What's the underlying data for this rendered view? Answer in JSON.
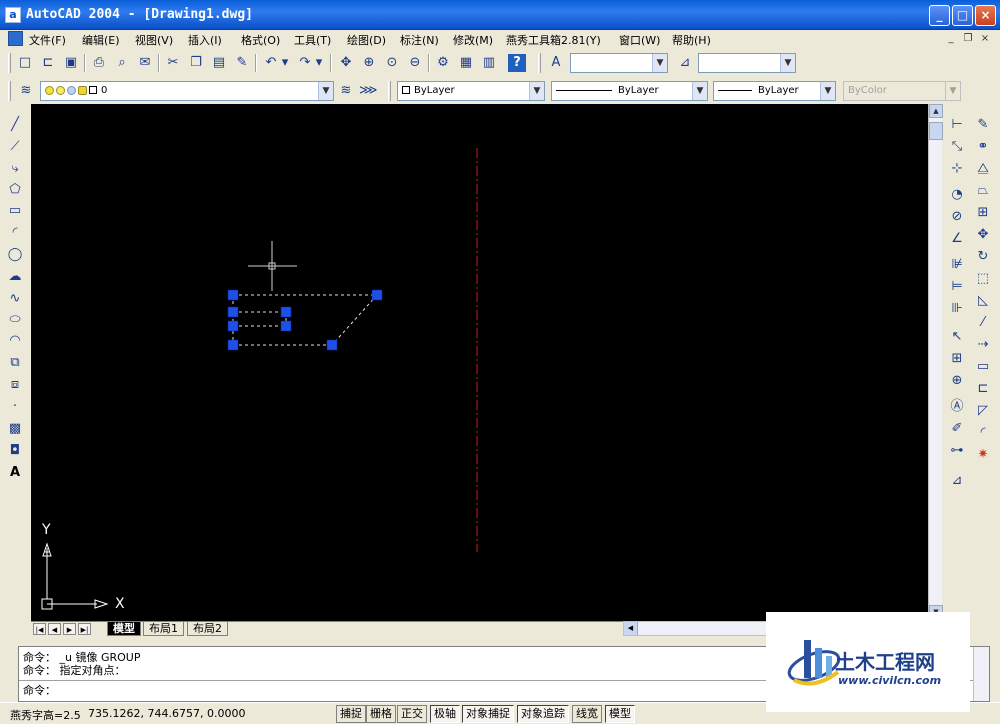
{
  "window": {
    "title": "AutoCAD 2004 - [Drawing1.dwg]",
    "app_icon_letter": "a",
    "minimize": "_",
    "maximize": "□",
    "close": "×"
  },
  "menu": {
    "items": [
      "文件(F)",
      "编辑(E)",
      "视图(V)",
      "插入(I)",
      "格式(O)",
      "工具(T)",
      "绘图(D)",
      "标注(N)",
      "修改(M)",
      "燕秀工具箱2.81(Y)",
      "窗口(W)",
      "帮助(H)"
    ],
    "mdi_minimize": "_",
    "mdi_restore": "❐",
    "mdi_close": "×"
  },
  "layers": {
    "current_layer": "0"
  },
  "properties": {
    "color": "ByLayer",
    "linetype": "ByLayer",
    "lineweight": "ByLayer",
    "plotstyle": "ByColor"
  },
  "axes": {
    "y_label": "Y",
    "x_label": "X"
  },
  "layout_tabs": {
    "model": "模型",
    "layout1": "布局1",
    "layout2": "布局2"
  },
  "command": {
    "line1": "命令： _u 镜像 GROUP",
    "line2": "命令： 指定对角点：",
    "prompt": "命令："
  },
  "status": {
    "text_height": "燕秀字高=2.5",
    "coords": "735.1262,  744.6757, 0.0000",
    "snap": "捕捉",
    "grid": "栅格",
    "ortho": "正交",
    "polar": "极轴",
    "osnap": "对象捕捉",
    "otrack": "对象追踪",
    "lwt": "线宽",
    "model": "模型"
  },
  "watermark": {
    "name": "土木工程网",
    "url": "www.civilcn.com"
  },
  "colors": {
    "canvas": "#000000",
    "grip": "#1e4fe8",
    "mirror_line": "#c81e1e",
    "title_bar": "#0a5fd8"
  }
}
